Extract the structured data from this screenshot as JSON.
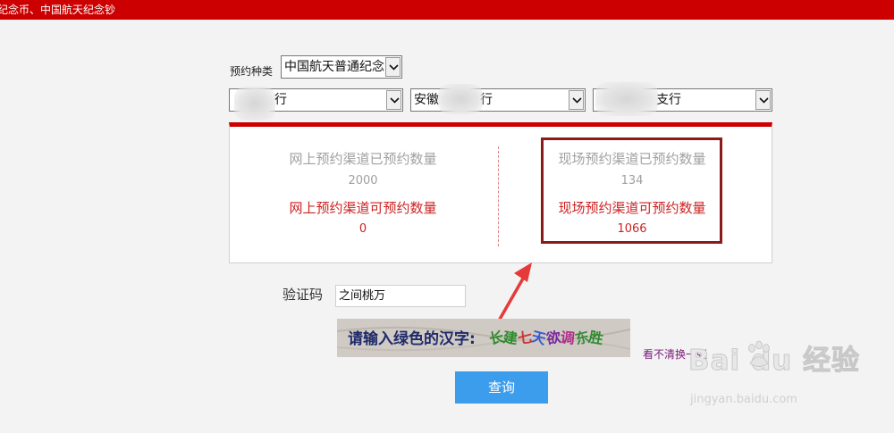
{
  "header": {
    "title": "纪念币、中国航天纪念钞"
  },
  "form": {
    "type_label": "预约种类",
    "type_select": "中国航天普通纪念",
    "bank_select_1": "行",
    "bank_select_2": "安徽",
    "bank_select_2_suffix": "行",
    "bank_select_3": "支行"
  },
  "panel": {
    "online_reserved_label": "网上预约渠道已预约数量",
    "online_reserved_value": "2000",
    "online_available_label": "网上预约渠道可预约数量",
    "online_available_value": "0",
    "onsite_reserved_label": "现场预约渠道已预约数量",
    "onsite_reserved_value": "134",
    "onsite_available_label": "现场预约渠道可预约数量",
    "onsite_available_value": "1066"
  },
  "captcha": {
    "label": "验证码",
    "input_value": "之间桃万",
    "prompt": "请输入绿色的汉字:",
    "chars": [
      "长",
      "建",
      "七",
      "天",
      "欲",
      "调",
      "东",
      "胜"
    ],
    "char_colors": [
      "#2e8b2e",
      "#2e8b2e",
      "#cc3333",
      "#3a5ad0",
      "#7a2a9a",
      "#b0308a",
      "#3a8a3a",
      "#2e8b2e"
    ],
    "refresh_link": "看不清换一张"
  },
  "actions": {
    "query_button": "查询"
  },
  "watermark": {
    "brand": "Bai du 经验",
    "url": "jingyan.baidu.com"
  },
  "colors": {
    "brand_red": "#cc0000",
    "button_blue": "#3d9ded",
    "highlight_border": "#8b1a1a",
    "arrow_red": "#e53a3a"
  },
  "icons": [
    "chevron-down-icon",
    "annotation-arrow",
    "baidu-paw-logo"
  ]
}
